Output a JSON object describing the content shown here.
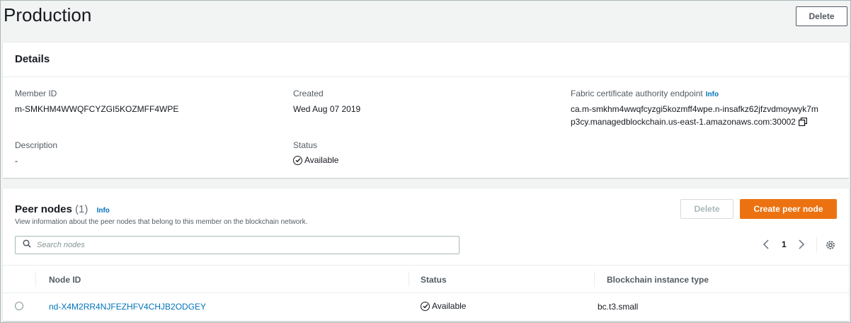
{
  "header": {
    "title": "Production",
    "delete_label": "Delete"
  },
  "details": {
    "title": "Details",
    "member_id_label": "Member ID",
    "member_id_value": "m-SMKHM4WWQFCYZGI5KOZMFF4WPE",
    "created_label": "Created",
    "created_value": "Wed Aug 07 2019",
    "ca_endpoint_label": "Fabric certificate authority endpoint",
    "ca_endpoint_info": "Info",
    "ca_endpoint_line1": "ca.m-smkhm4wwqfcyzgi5kozmff4wpe.n-insafkz62jfzvdmoywyk7m",
    "ca_endpoint_line2": "p3cy.managedblockchain.us-east-1.amazonaws.com:30002",
    "description_label": "Description",
    "description_value": "-",
    "status_label": "Status",
    "status_value": "Available"
  },
  "peer_nodes": {
    "title": "Peer nodes",
    "count": "(1)",
    "info": "Info",
    "description": "View information about the peer nodes that belong to this member on the blockchain network.",
    "delete_label": "Delete",
    "create_label": "Create peer node",
    "search_placeholder": "Search nodes",
    "page_number": "1",
    "columns": [
      "Node ID",
      "Status",
      "Blockchain instance type"
    ],
    "rows": [
      {
        "node_id": "nd-X4M2RR4NJFEZHFV4CHJB2ODGEY",
        "status": "Available",
        "instance_type": "bc.t3.small"
      }
    ]
  },
  "colors": {
    "primary": "#ec7211",
    "link": "#0073bb",
    "text": "#16191f",
    "muted": "#545b64"
  },
  "icons": [
    "search-icon",
    "chevron-left-icon",
    "chevron-right-icon",
    "settings-icon",
    "check-circle-icon",
    "copy-icon"
  ]
}
